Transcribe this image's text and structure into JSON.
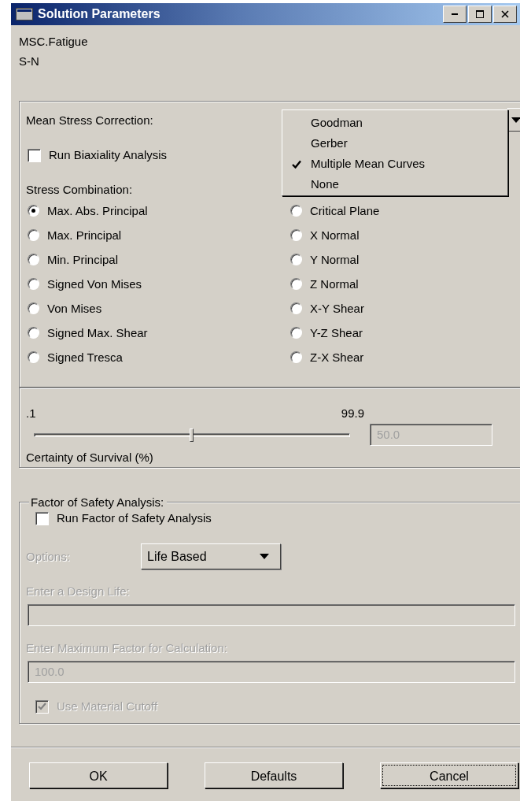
{
  "window": {
    "title": "Solution Parameters"
  },
  "header_lines": [
    "MSC.Fatigue",
    "S-N"
  ],
  "mean_stress_correction": {
    "label": "Mean Stress Correction:",
    "options": [
      {
        "label": "Goodman",
        "selected": false
      },
      {
        "label": "Gerber",
        "selected": false
      },
      {
        "label": "Multiple Mean Curves",
        "selected": true
      },
      {
        "label": "None",
        "selected": false
      }
    ]
  },
  "biaxiality": {
    "label": "Run Biaxiality Analysis",
    "checked": false
  },
  "stress_combination": {
    "label": "Stress Combination:",
    "options": [
      {
        "label": "Max. Abs. Principal",
        "selected": true
      },
      {
        "label": "Max. Principal",
        "selected": false
      },
      {
        "label": "Min. Principal",
        "selected": false
      },
      {
        "label": "Signed Von Mises",
        "selected": false
      },
      {
        "label": "Von Mises",
        "selected": false
      },
      {
        "label": "Signed Max. Shear",
        "selected": false
      },
      {
        "label": "Signed Tresca",
        "selected": false
      },
      {
        "label": "Critical Plane",
        "selected": false
      },
      {
        "label": "X Normal",
        "selected": false
      },
      {
        "label": "Y Normal",
        "selected": false
      },
      {
        "label": "Z Normal",
        "selected": false
      },
      {
        "label": "X-Y Shear",
        "selected": false
      },
      {
        "label": "Y-Z Shear",
        "selected": false
      },
      {
        "label": "Z-X Shear",
        "selected": false
      }
    ]
  },
  "certainty": {
    "min_label": ".1",
    "max_label": "99.9",
    "level": 0.5,
    "value": "50.0",
    "disabled": true,
    "label": "Certainty of Survival (%)"
  },
  "factor_of_safety": {
    "title": "Factor of Safety Analysis:",
    "run": {
      "label": "Run Factor of Safety Analysis",
      "checked": false
    },
    "options": {
      "label": "Options:",
      "value": "Life Based",
      "disabled": true
    },
    "design_life": {
      "label": "Enter a Design Life:",
      "disabled": true
    },
    "max_factor": {
      "label": "Enter Maximum Factor for Calculation:",
      "value": "100.0",
      "disabled": true
    },
    "cutoff": {
      "label": "Use Material Cutoff",
      "checked": true,
      "disabled": true
    }
  },
  "buttons": [
    {
      "label": "OK",
      "focused": false
    },
    {
      "label": "Defaults",
      "focused": false
    },
    {
      "label": "Cancel",
      "focused": true
    }
  ]
}
